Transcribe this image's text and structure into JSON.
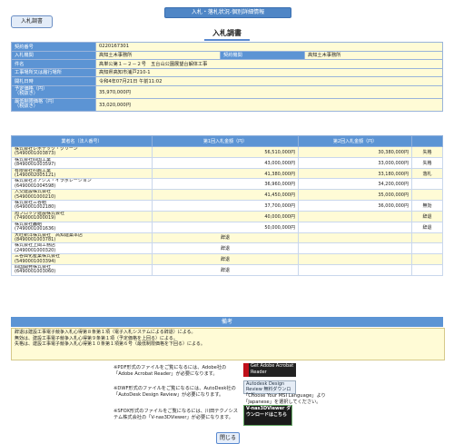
{
  "header": {
    "top_title": "入札・落札状況-個別詳細情報",
    "tab": "入札調書",
    "page_title": "入札調書"
  },
  "info": {
    "contract_no": {
      "label": "契約番号",
      "value": "0220167301"
    },
    "bidder_org": {
      "label": "入札機関",
      "value": "高知土木事務所"
    },
    "contract_org": {
      "label": "契約機関",
      "value": "高知土木事務所"
    },
    "project": {
      "label": "件名",
      "value": "高単公第１－２－２号　五台山公園展望台解体工事"
    },
    "location": {
      "label": "工事場所又は履行場所",
      "value": "高知県高知市浦戸210-1"
    },
    "date": {
      "label": "開札日時",
      "value": "令和4年07月21日 午前11:02"
    },
    "estimate": {
      "label": "予定価格（円）\n（税抜き）",
      "value": "35,970,000円"
    },
    "min_price": {
      "label": "最低制限価格（円）\n（税抜き）",
      "value": "33,020,000円"
    }
  },
  "bids": {
    "headers": [
      "業者名（法人番号）",
      "第1回入札金額（円）",
      "第2回入札金額（円）",
      ""
    ],
    "rows": [
      {
        "name": "株式会社レボテック・クリーン",
        "id": "(5490001003873)",
        "r1": "56,510,000円",
        "r2": "30,380,000円",
        "result": "失格"
      },
      {
        "name": "株式会社四国工業",
        "id": "(8490001003597)",
        "r1": "43,000,000円",
        "r2": "33,000,000円",
        "result": "失格"
      },
      {
        "name": "有限会社村越工業",
        "id": "(1490002005121)",
        "r1": "41,380,000円",
        "r2": "33,180,000円",
        "result": "落札"
      },
      {
        "name": "株式会社オアシス・イラボレーション",
        "id": "(6490001004598)",
        "r1": "36,960,000円",
        "r2": "34,200,000円",
        "result": ""
      },
      {
        "name": "入交建設株式会社",
        "id": "(5490001000210)",
        "r1": "41,450,000円",
        "r2": "35,000,000円",
        "result": ""
      },
      {
        "name": "株式会社三谷組",
        "id": "(6490001002180)",
        "r1": "37,700,000円",
        "r2": "36,000,000円",
        "result": "無効"
      },
      {
        "name": "旭ブロック建設株式会社",
        "id": "(7490001000019)",
        "r1": "40,000,000円",
        "r2": "",
        "result": "辞退"
      },
      {
        "name": "株式会社轟組",
        "id": "(7490001001636)",
        "r1": "50,000,000円",
        "r2": "",
        "result": "辞退"
      },
      {
        "name": "大旺新洋株式会社　高知建築本店",
        "id": "(8490001003781)",
        "r1": "辞退",
        "r2": "",
        "result": ""
      },
      {
        "name": "株式会社上岡工務店",
        "id": "(2490001000320)",
        "r1": "辞退",
        "r2": "",
        "result": ""
      },
      {
        "name": "三谷興化産業株式会社",
        "id": "(5490001003394)",
        "r1": "辞退",
        "r2": "",
        "result": ""
      },
      {
        "name": "四国開発株式会社",
        "id": "(6490001003060)",
        "r1": "辞退",
        "r2": "",
        "result": ""
      }
    ]
  },
  "remarks": {
    "header": "備考",
    "lines": [
      "辞退は建設工事電子競争入札心得第８条第１項（電子入札システムによる辞退）による。",
      "無効は、建設工事電子競争入札心得第９条第１項（予定価格を上回る）による。",
      "失格は、建設工事電子競争入札心得第１０条第１項第６号（最低制限価格を下回る）による。"
    ]
  },
  "notes": {
    "pdf": "※PDF形式のファイルをご覧になるには、Adobe社の「Adobe Acrobat Reader」が必要になります。",
    "dwf": "※DWF形式のファイルをご覧になるには、AutoDesk社の「AutoDesk Design Review」が必要になります。",
    "dwf_right": "「Choose Your MSI Language」より「Japanese」を選択してください。",
    "sfc": "※SFOX形式のファイルをご覧になるには、川田テクノシステム株式会社の「V-nas3DViewer」が必要になります。",
    "badge_adobe": "Get Adobe Acrobat Reader",
    "badge_autodesk": "Autodesk Design Review 無料ダウンロード",
    "badge_vnas": "V-nas3DViewer ダウンロードはこちら"
  },
  "buttons": {
    "close": "閉じる"
  }
}
